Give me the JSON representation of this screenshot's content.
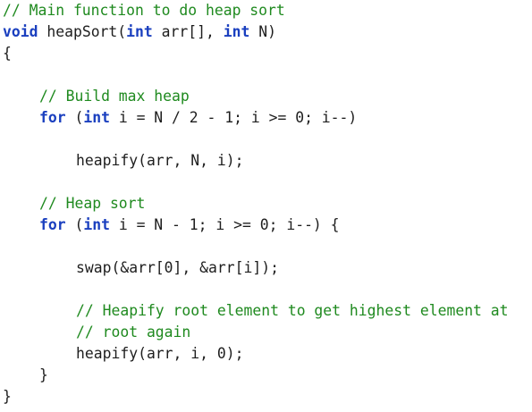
{
  "lines": [
    {
      "comment": "// Main function to do heap sort"
    },
    {
      "ret_type": "void",
      "name_open": " heapSort(",
      "t1": "int",
      "p1": " arr[], ",
      "t2": "int",
      "p2": " N)"
    },
    {
      "text": "{"
    },
    {
      "text": ""
    },
    {
      "comment": "// Build max heap"
    },
    {
      "kw": "for",
      "open": " (",
      "type": "int",
      "rest": " i = N / 2 - 1; i >= 0; i--)"
    },
    {
      "text": ""
    },
    {
      "text": "heapify(arr, N, i);"
    },
    {
      "text": ""
    },
    {
      "comment": "// Heap sort"
    },
    {
      "kw": "for",
      "open": " (",
      "type": "int",
      "rest": " i = N - 1; i >= 0; i--) {"
    },
    {
      "text": ""
    },
    {
      "text": "swap(&arr[0], &arr[i]);"
    },
    {
      "text": ""
    },
    {
      "comment": "// Heapify root element to get highest element at"
    },
    {
      "comment": "// root again"
    },
    {
      "text": "heapify(arr, i, 0);"
    },
    {
      "text": "}"
    },
    {
      "text": "}"
    }
  ]
}
